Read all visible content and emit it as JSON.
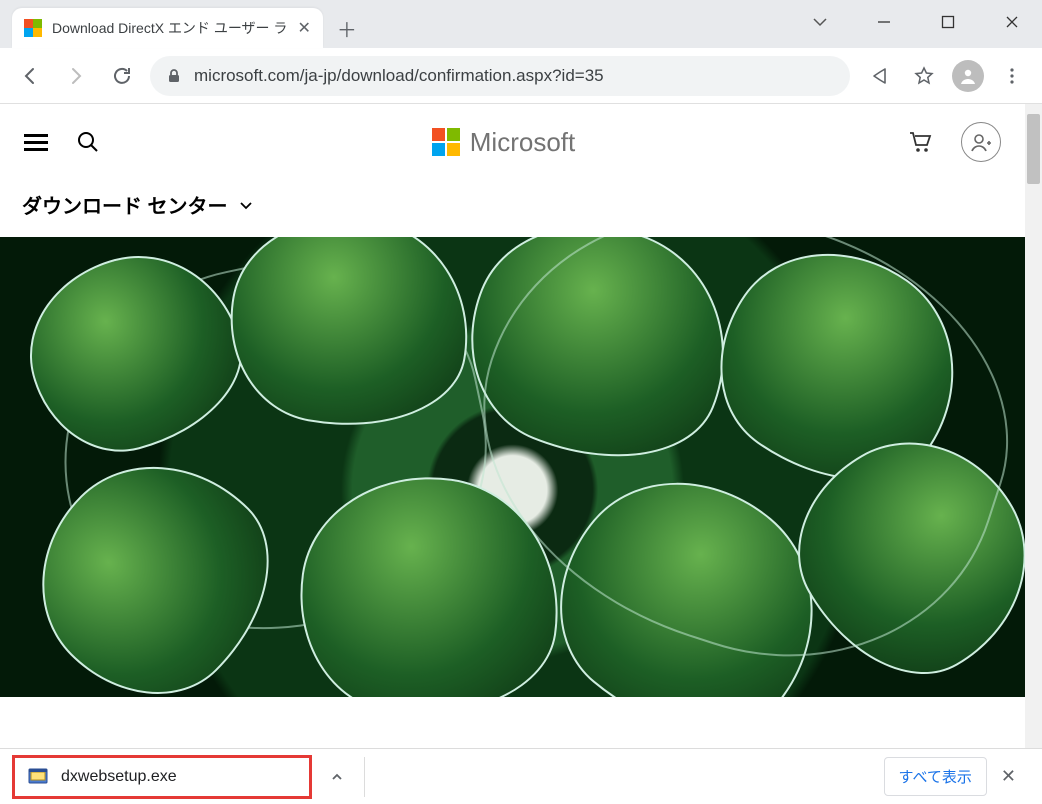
{
  "tab": {
    "title": "Download DirectX エンド ユーザー ラ"
  },
  "url": "microsoft.com/ja-jp/download/confirmation.aspx?id=35",
  "msHeader": {
    "brand": "Microsoft"
  },
  "breadcrumb": {
    "label": "ダウンロード センター"
  },
  "download": {
    "filename": "dxwebsetup.exe",
    "showAll": "すべて表示"
  }
}
